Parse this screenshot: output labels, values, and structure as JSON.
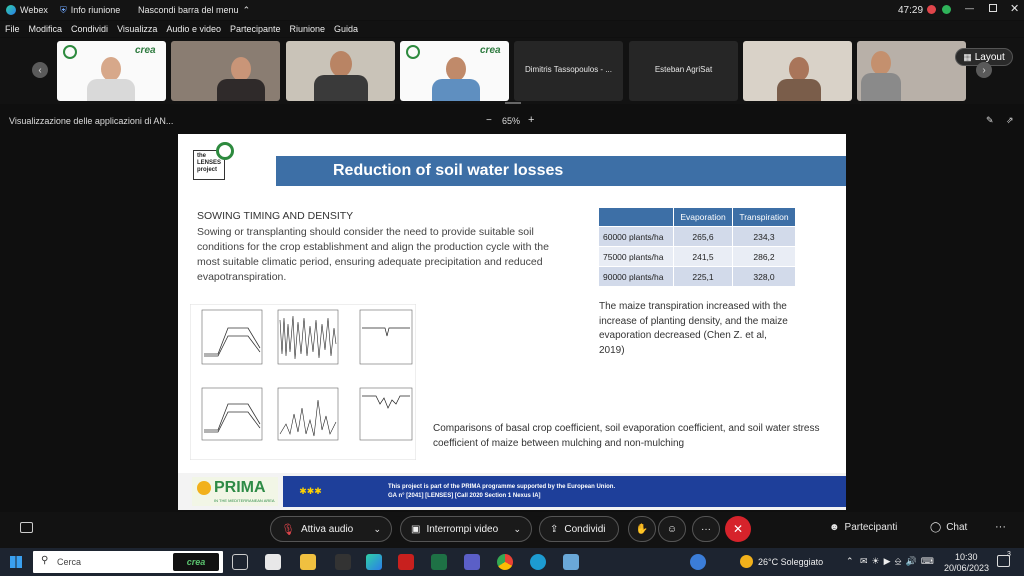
{
  "titlebar": {
    "app_name": "Webex",
    "meeting_info": "Info riunione",
    "hide_menu": "Nascondi barra del menu",
    "timer": "47:29"
  },
  "menu": [
    "File",
    "Modifica",
    "Condividi",
    "Visualizza",
    "Audio e video",
    "Partecipante",
    "Riunione",
    "Guida"
  ],
  "participants": {
    "tile5": "Dimitris Tassopoulos - ...",
    "tile6": "Esteban AgriSat",
    "crea_label": "crea",
    "layout": "Layout"
  },
  "share": {
    "title": "Visualizzazione delle applicazioni di AN...",
    "zoom": "65%",
    "minus": "−",
    "plus": "+"
  },
  "slide": {
    "logo": [
      "the",
      "LENSES",
      "project"
    ],
    "title": "Reduction of soil water losses",
    "heading": "SOWING TIMING AND DENSITY",
    "body": "Sowing or transplanting should consider the need to provide suitable soil conditions for the crop establishment and align the production cycle with the most suitable climatic period, ensuring adequate precipitation and reduced evapotranspiration.",
    "table": {
      "headers": [
        "",
        "Evaporation",
        "Transpiration"
      ],
      "rows": [
        [
          "60000 plants/ha",
          "265,6",
          "234,3"
        ],
        [
          "75000 plants/ha",
          "241,5",
          "286,2"
        ],
        [
          "90000 plants/ha",
          "225,1",
          "328,0"
        ]
      ]
    },
    "note": "The maize transpiration increased with the increase of planting density, and the maize evaporation decreased (Chen Z. et al, 2019)",
    "caption": "Comparisons of basal crop coefficient, soil evaporation coefficient, and soil water stress coefficient of maize between mulching and non-mulching",
    "prima": "PRIMA",
    "prima_sub": "IN THE MEDITERRANEAN AREA",
    "footer1": "This project is part of the PRIMA programme supported by the European Union.",
    "footer2": "GA n° [2041] [LENSES] [Call 2020 Section 1 Nexus IA]"
  },
  "controls": {
    "mute": "Attiva audio",
    "video": "Interrompi video",
    "share": "Condividi",
    "participants": "Partecipanti",
    "chat": "Chat",
    "more": "···"
  },
  "taskbar": {
    "search": "Cerca",
    "crea": "crea",
    "weather": "26°C  Soleggiato",
    "time": "10:30",
    "date": "20/06/2023",
    "notif": "3"
  },
  "colors": {
    "accent": "#3d6fa6",
    "end_call": "#d6232b",
    "background": "#0f0f0f"
  }
}
